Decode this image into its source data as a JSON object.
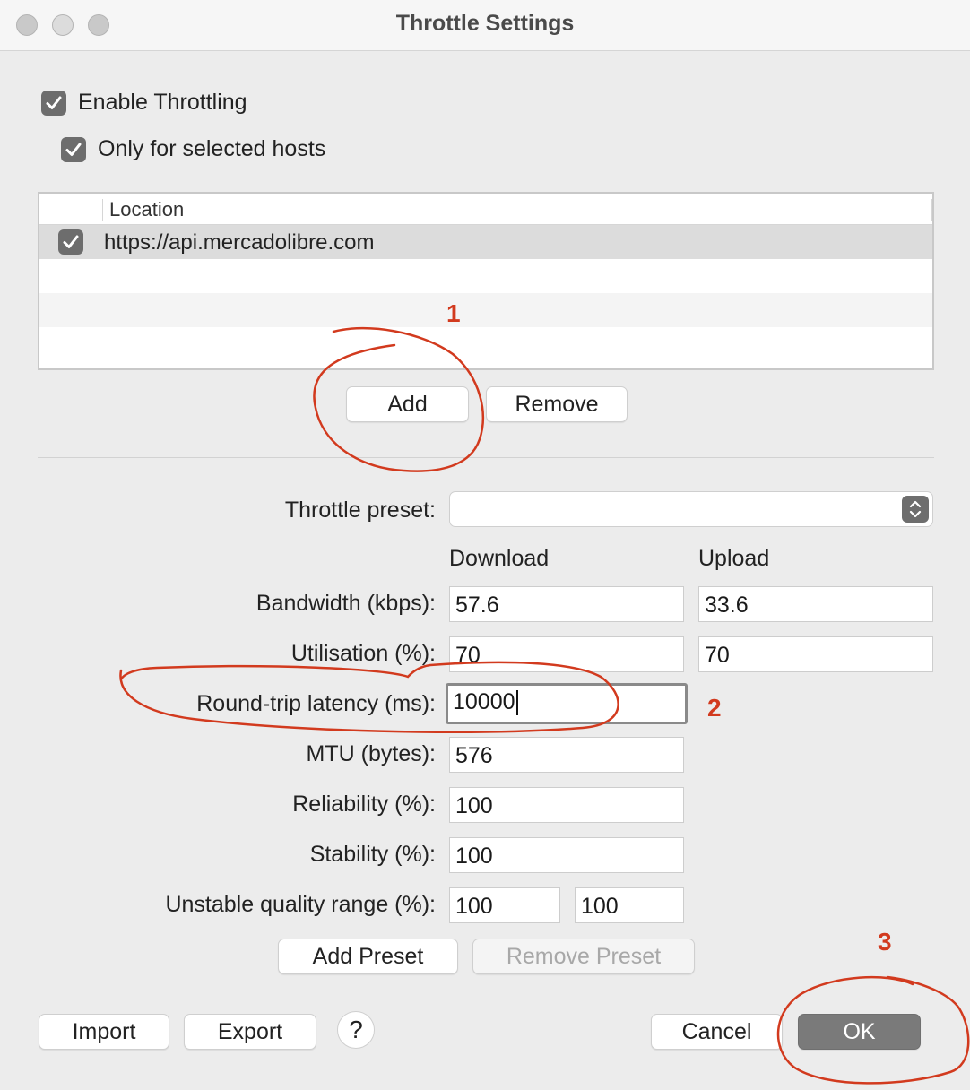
{
  "window": {
    "title": "Throttle Settings"
  },
  "options": {
    "enable_throttling": {
      "label": "Enable Throttling",
      "checked": true
    },
    "only_selected_hosts": {
      "label": "Only for selected hosts",
      "checked": true
    }
  },
  "hosts_table": {
    "column_header": "Location",
    "rows": [
      {
        "checked": true,
        "location": "https://api.mercadolibre.com"
      }
    ],
    "add_label": "Add",
    "remove_label": "Remove"
  },
  "preset": {
    "label": "Throttle preset:",
    "value": ""
  },
  "columns": {
    "download": "Download",
    "upload": "Upload"
  },
  "fields": {
    "bandwidth": {
      "label": "Bandwidth (kbps):",
      "download": "57.6",
      "upload": "33.6"
    },
    "utilisation": {
      "label": "Utilisation (%):",
      "download": "70",
      "upload": "70"
    },
    "latency": {
      "label": "Round-trip latency (ms):",
      "value": "10000"
    },
    "mtu": {
      "label": "MTU (bytes):",
      "value": "576"
    },
    "reliability": {
      "label": "Reliability (%):",
      "value": "100"
    },
    "stability": {
      "label": "Stability (%):",
      "value": "100"
    },
    "unstable_range": {
      "label": "Unstable quality range (%):",
      "min": "100",
      "max": "100"
    }
  },
  "preset_buttons": {
    "add": "Add Preset",
    "remove": "Remove Preset"
  },
  "footer": {
    "import": "Import",
    "export": "Export",
    "help": "?",
    "cancel": "Cancel",
    "ok": "OK"
  },
  "annotations": {
    "step1": "1",
    "step2": "2",
    "step3": "3",
    "color": "#d23a1e"
  }
}
